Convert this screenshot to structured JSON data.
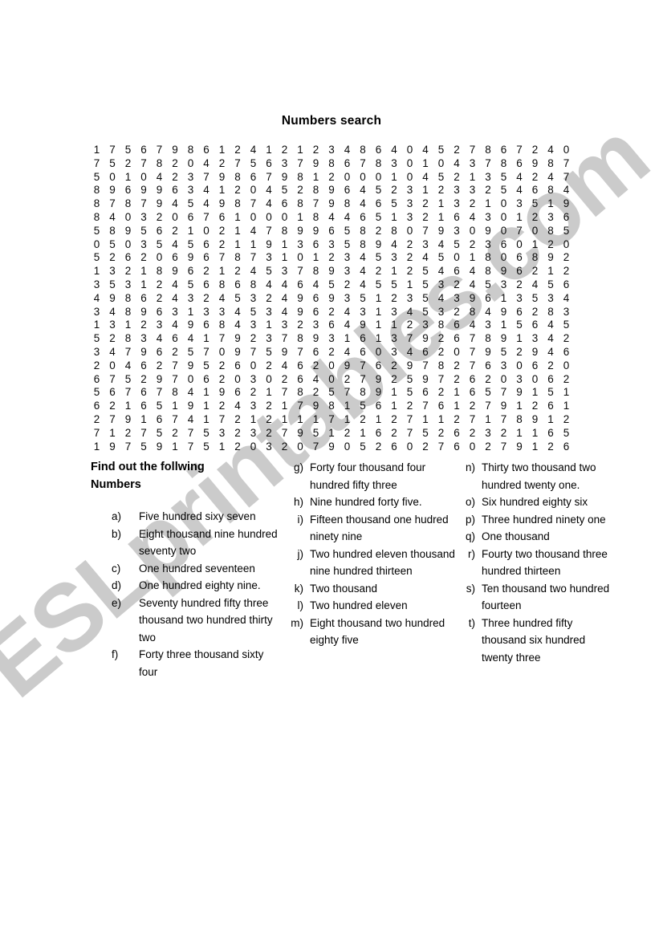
{
  "title": "Numbers search",
  "watermark": {
    "text": "ESLprintables.com"
  },
  "instructions": "Find out the follwing Numbers",
  "grid": {
    "columns": 33,
    "rows": 22,
    "digits": [
      "1 7 5 6 7 9 8 6 1 2 4 1 2 1 2 3 4 8 6 4 0 4 5 2 7 8 6 7 2 4 0",
      "7 5 2 7 8 2 0 4 2 7 5 6 3 7 9 8 6 7 8 3 0 1 0 4 3 7 8 6 9 8 7",
      "5 0 1 0 4 2 3 7 9 8 6 7 9 8 1 2 0 0 0 1 0 4 5 2 1 3 5 4 2 4 7",
      "8 9 6 9 9 6 3 4 1 2 0 4 5 2 8 9 6 4 5 2 3 1 2 3 3 2 5 4 6 8 4",
      "8 7 8 7 9 4 5 4 9 8 7 4 6 8 7 9 8 4 6 5 3 2 1 3 2 1 0 3 5 1 9",
      "8 4 0 3 2 0 6 7 6 1 0 0 0 1 8 4 4 6 5 1 3 2 1 6 4 3 0 1 2 3 6",
      "5 8 9 5 6 2 1 0 2 1 4 7 8 9 9 6 5 8 2 8 0 7 9 3 0 9 0 7 0 8 5",
      "0 5 0 3 5 4 5 6 2 1 1 9 1 3 6 3 5 8 9 4 2 3 4 5 2 3 6 0 1 2 0",
      "5 2 6 2 0 6 9 6 7 8 7 3 1 0 1 2 3 4 5 3 2 4 5 0 1 8 0 6 8 9 2",
      "1 3 2 1 8 9 6 2 1 2 4 5 3 7 8 9 3 4 2 1 2 5 4 6 4 8 9 6 2 1 2",
      "3 5 3 1 2 4 5 6 8 6 8 4 4 6 4 5 2 4 5 5 1 5 3 2 4 5 3 2 4 5 6",
      "4 9 8 6 2 4 3 2 4 5 3 2 4 9 6 9 3 5 1 2 3 5 4 3 9 6 1 3 5 3 4",
      "3 4 8 9 6 3 1 3 3 4 5 3 4 9 6 2 4 3 1 3 4 5 3 2 8 4 9 6 2 8 3",
      "1 3 1 2 3 4 9 6 8 4 3 1 3 2 3 6 4 9 1 1 2 3 8 6 4 3 1 5 6 4 5",
      "5 2 8 3 4 6 4 1 7 9 2 3 7 8 9 3 1 6 1 3 7 9 2 6 7 8 9 1 3 4 2",
      "3 4 7 9 6 2 5 7 0 9 7 5 9 7 6 2 4 6 0 3 4 6 2 0 7 9 5 2 9 4 6",
      "2 0 4 6 2 7 9 5 2 6 0 2 4 6 2 0 9 7 6 2 9 7 8 2 7 6 3 0 6 2 0",
      "6 7 5 2 9 7 0 6 2 0 3 0 2 6 4 0 2 7 9 2 5 9 7 2 6 2 0 3 0 6 2",
      "5 6 7 6 7 8 4 1 9 6 2 1 7 8 2 5 7 8 9 1 5 6 2 1 6 5 7 9 1 5 1",
      "6 2 1 6 5 1 9 1 2 4 3 2 1 7 9 8 1 5 6 1 2 7 6 1 2 7 9 1 2 6 1",
      "2 7 9 1 6 7 4 1 7 2 1 2 1 1 1 7 1 2 1 2 7 1 1 2 7 1 7 8 9 1 2",
      "7 1 2 7 5 2 7 5 3 2 3 2 7 9 5 1 2 1 6 2 7 5 2 6 2 3 2 1 1 6 5",
      "1 9 7 5 9 1 7 5 1 2 0 3 2 0 7 9 0 5 2 6 0 2 7 6 0 2 7 9 1 2 6"
    ]
  },
  "clues": {
    "column_1": [
      {
        "marker": "a)",
        "text": "Five hundred sixy seven"
      },
      {
        "marker": "b)",
        "text": "Eight thousand nine hundred seventy two"
      },
      {
        "marker": "c)",
        "text": "One hundred seventeen"
      },
      {
        "marker": "d)",
        "text": "One hundred eighty nine."
      },
      {
        "marker": "e)",
        "text": "Seventy hundred fifty three thousand two hundred thirty two"
      },
      {
        "marker": "f)",
        "text": "Forty three thousand sixty four"
      }
    ],
    "column_2": [
      {
        "marker": "g)",
        "text": "Forty four thousand four hundred fifty three"
      },
      {
        "marker": "h)",
        "text": "Nine hundred forty five."
      },
      {
        "marker": "i)",
        "text": "Fifteen thousand one hudred ninety nine"
      },
      {
        "marker": "j)",
        "text": "Two hundred eleven thousand nine hundred thirteen"
      },
      {
        "marker": "k)",
        "text": "Two thousand"
      },
      {
        "marker": "l)",
        "text": "Two hundred eleven"
      },
      {
        "marker": "m)",
        "text": "Eight thousand two hundred eighty five"
      }
    ],
    "column_3": [
      {
        "marker": "n)",
        "text": "Thirty two thousand two hundred twenty one."
      },
      {
        "marker": "o)",
        "text": "Six hundred eighty six"
      },
      {
        "marker": "p)",
        "text": "Three hundred ninety one"
      },
      {
        "marker": "q)",
        "text": "One thousand"
      },
      {
        "marker": "r)",
        "text": "Fourty two thousand three hundred thirteen"
      },
      {
        "marker": "s)",
        "text": "Ten thousand two hundred fourteen"
      },
      {
        "marker": "t)",
        "text": "Three hundred fifty thousand six hundred twenty three"
      }
    ]
  }
}
